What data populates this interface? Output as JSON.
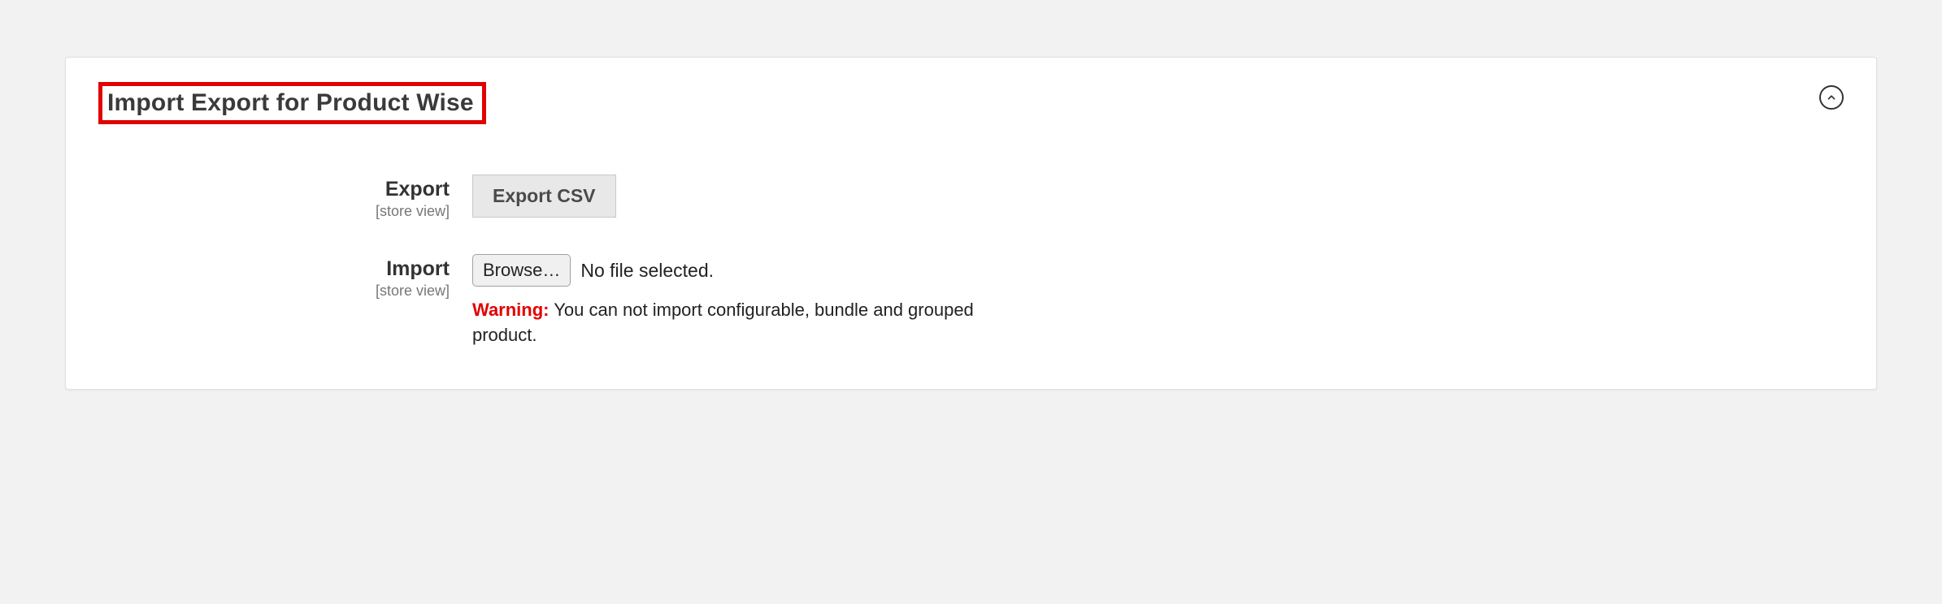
{
  "panel": {
    "title": "Import Export for Product Wise"
  },
  "fields": {
    "export": {
      "label": "Export",
      "scope": "[store view]",
      "button": "Export CSV"
    },
    "import": {
      "label": "Import",
      "scope": "[store view]",
      "browse": "Browse…",
      "file_status": "No file selected.",
      "warning_label": "Warning:",
      "warning_text": " You can not import configurable, bundle and grouped product."
    }
  }
}
